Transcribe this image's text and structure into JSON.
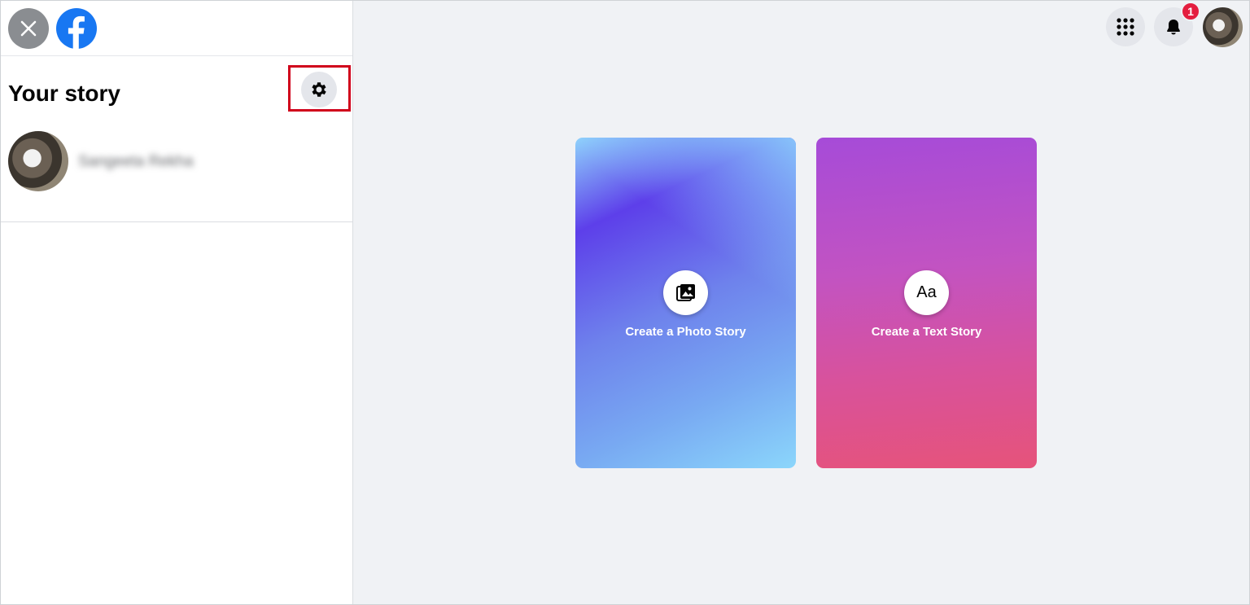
{
  "sidebar": {
    "story_title": "Your story",
    "user_name": "Sangeeta Rekha"
  },
  "header": {
    "notification_count": "1"
  },
  "cards": {
    "photo": {
      "label": "Create a Photo Story",
      "icon": "photo-icon"
    },
    "text": {
      "label": "Create a Text Story",
      "icon_text": "Aa"
    }
  },
  "colors": {
    "facebook_blue": "#1877f2",
    "badge_red": "#e41e3f",
    "highlight_red": "#d0021b"
  }
}
